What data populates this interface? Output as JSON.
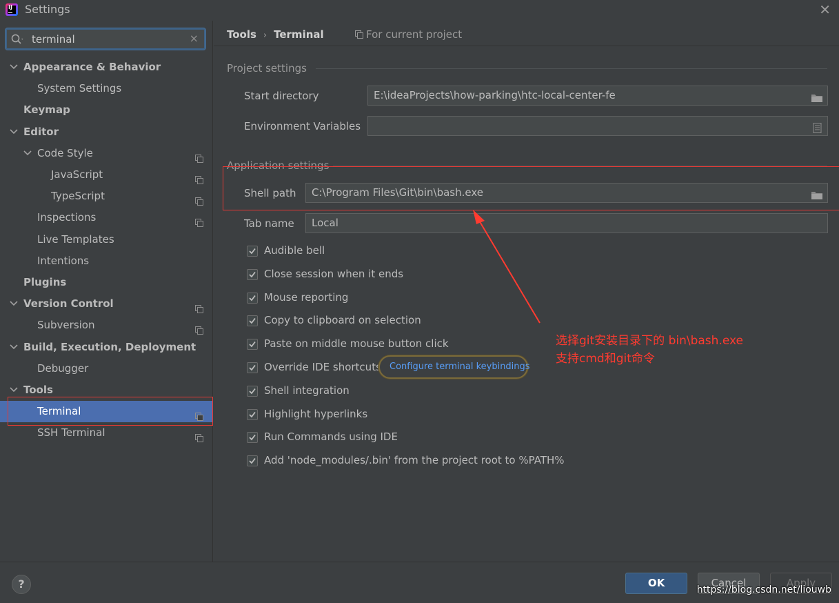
{
  "window": {
    "title": "Settings",
    "close_glyph": "✕",
    "app_icon": "intellij-icon"
  },
  "search": {
    "value": "terminal",
    "icon": "search-icon",
    "clear_glyph": "×"
  },
  "sidebar": {
    "items": [
      {
        "label": "Appearance & Behavior",
        "level": 0,
        "expandable": true,
        "bold": true
      },
      {
        "label": "System Settings",
        "level": 1,
        "expandable": false,
        "bold": false
      },
      {
        "label": "Keymap",
        "level": 0,
        "expandable": false,
        "bold": true
      },
      {
        "label": "Editor",
        "level": 0,
        "expandable": true,
        "bold": true
      },
      {
        "label": "Code Style",
        "level": 1,
        "expandable": true,
        "bold": false,
        "project": true
      },
      {
        "label": "JavaScript",
        "level": 2,
        "expandable": false,
        "bold": false,
        "project": true
      },
      {
        "label": "TypeScript",
        "level": 2,
        "expandable": false,
        "bold": false,
        "project": true
      },
      {
        "label": "Inspections",
        "level": 1,
        "expandable": false,
        "bold": false,
        "project": true
      },
      {
        "label": "Live Templates",
        "level": 1,
        "expandable": false,
        "bold": false
      },
      {
        "label": "Intentions",
        "level": 1,
        "expandable": false,
        "bold": false
      },
      {
        "label": "Plugins",
        "level": 0,
        "expandable": false,
        "bold": true
      },
      {
        "label": "Version Control",
        "level": 0,
        "expandable": true,
        "bold": true,
        "project": true
      },
      {
        "label": "Subversion",
        "level": 1,
        "expandable": false,
        "bold": false,
        "project": true
      },
      {
        "label": "Build, Execution, Deployment",
        "level": 0,
        "expandable": true,
        "bold": true
      },
      {
        "label": "Debugger",
        "level": 1,
        "expandable": false,
        "bold": false
      },
      {
        "label": "Tools",
        "level": 0,
        "expandable": true,
        "bold": true
      },
      {
        "label": "Terminal",
        "level": 1,
        "expandable": false,
        "bold": false,
        "project": true,
        "selected": true
      },
      {
        "label": "SSH Terminal",
        "level": 1,
        "expandable": false,
        "bold": false,
        "project": true
      }
    ]
  },
  "header": {
    "crumb_parent": "Tools",
    "crumb_sep": "›",
    "crumb_current": "Terminal",
    "for_project": "For current project"
  },
  "project_settings": {
    "title": "Project settings",
    "start_directory_label": "Start directory",
    "start_directory_value": "E:\\ideaProjects\\how-parking\\htc-local-center-fe",
    "env_vars_label": "Environment Variables",
    "env_vars_value": ""
  },
  "application_settings": {
    "title": "Application settings",
    "shell_path_label": "Shell path",
    "shell_path_value": "C:\\Program Files\\Git\\bin\\bash.exe",
    "tab_name_label": "Tab name",
    "tab_name_value": "Local"
  },
  "checkboxes": [
    {
      "label": "Audible bell",
      "checked": true
    },
    {
      "label": "Close session when it ends",
      "checked": true
    },
    {
      "label": "Mouse reporting",
      "checked": true
    },
    {
      "label": "Copy to clipboard on selection",
      "checked": true
    },
    {
      "label": "Paste on middle mouse button click",
      "checked": true
    },
    {
      "label": "Override IDE shortcuts",
      "checked": true
    },
    {
      "label": "Shell integration",
      "checked": true
    },
    {
      "label": "Highlight hyperlinks",
      "checked": true
    },
    {
      "label": "Run Commands using IDE",
      "checked": true
    },
    {
      "label": "Add 'node_modules/.bin' from the project root to %PATH%",
      "checked": true
    }
  ],
  "keybindings_link": "Configure terminal keybindings",
  "annotation": {
    "line1": "选择git安装目录下的 bin\\bash.exe",
    "line2": "支持cmd和git命令",
    "color": "#ff3b30"
  },
  "footer": {
    "help_glyph": "?",
    "ok": "OK",
    "cancel": "Cancel",
    "apply": "Apply",
    "watermark": "https://blog.csdn.net/liouwb"
  },
  "colors": {
    "selection": "#4b6eaf",
    "link": "#589df6",
    "highlight_box": "#e53935"
  }
}
